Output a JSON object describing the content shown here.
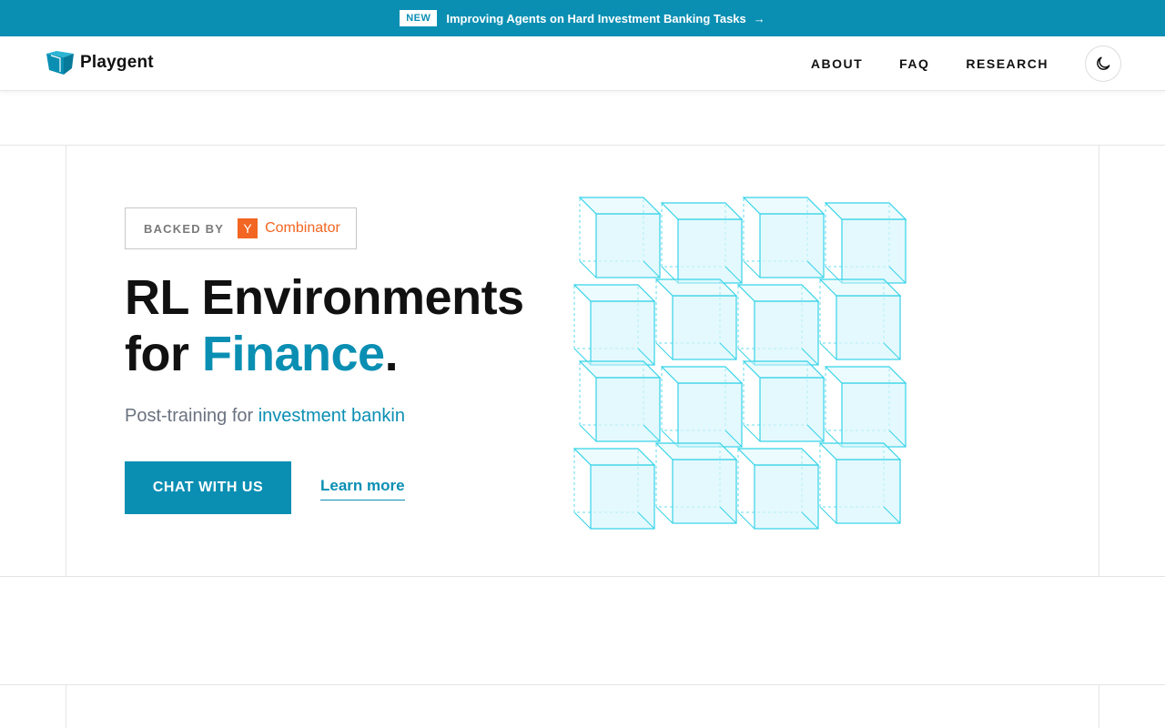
{
  "banner": {
    "badge": "NEW",
    "text": "Improving Agents on Hard Investment Banking Tasks",
    "arrow": "→"
  },
  "nav": {
    "brand": "Playgent",
    "links": [
      "ABOUT",
      "FAQ",
      "RESEARCH"
    ],
    "theme_icon": "moon-icon"
  },
  "hero": {
    "backed_by": "BACKED BY",
    "yc_letter": "Y",
    "yc_name": "Combinator",
    "headline_line1": "RL Environments",
    "headline_line2_prefix": "for ",
    "headline_accent": "Finance",
    "headline_period": ".",
    "sub_prefix": "Post-training for ",
    "sub_accent": "investment bankin",
    "cta_label": "CHAT WITH US",
    "learn_label": "Learn more"
  },
  "colors": {
    "accent": "#0a8fb3",
    "yc_orange": "#f26522",
    "cube_stroke": "#35d3e8",
    "cube_fill": "#d9f7fc"
  }
}
